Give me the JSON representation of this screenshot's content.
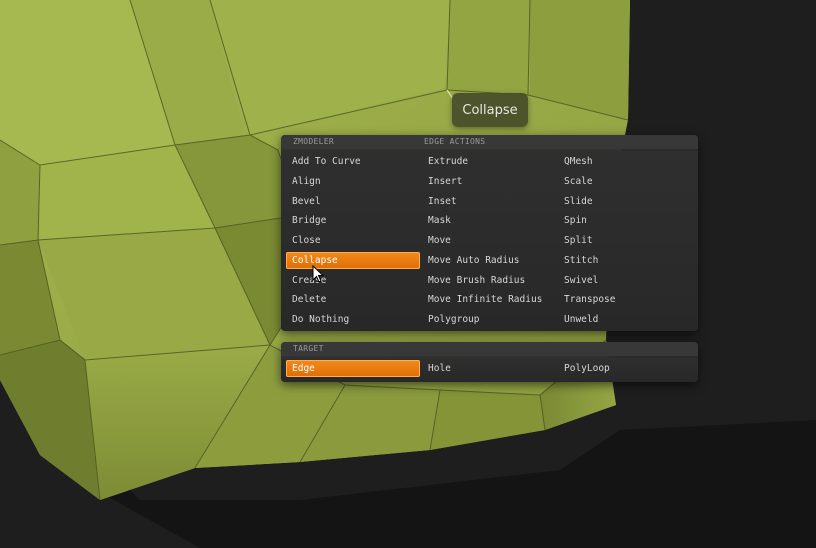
{
  "tooltip": {
    "label": "Collapse"
  },
  "zmodeler": {
    "header_left": "ZMODELER",
    "header_right": "EDGE ACTIONS",
    "columns": [
      [
        "Add To Curve",
        "Align",
        "Bevel",
        "Bridge",
        "Close",
        "Collapse",
        "Crease",
        "Delete",
        "Do Nothing"
      ],
      [
        "Extrude",
        "Insert",
        "Inset",
        "Mask",
        "Move",
        "Move Auto Radius",
        "Move Brush Radius",
        "Move Infinite Radius",
        "Polygroup"
      ],
      [
        "QMesh",
        "Scale",
        "Slide",
        "Spin",
        "Split",
        "Stitch",
        "Swivel",
        "Transpose",
        "Unweld"
      ]
    ],
    "selected": "Collapse"
  },
  "target": {
    "header": "TARGET",
    "items": [
      "Edge",
      "Hole",
      "PolyLoop"
    ],
    "selected": "Edge"
  },
  "colors": {
    "mesh": "#8a9a3e",
    "mesh_light": "#a1b24c",
    "mesh_dark": "#6b7a2c",
    "selection": "#ee7d12",
    "panel": "#2c2c2c",
    "background": "#1e1e1e"
  }
}
